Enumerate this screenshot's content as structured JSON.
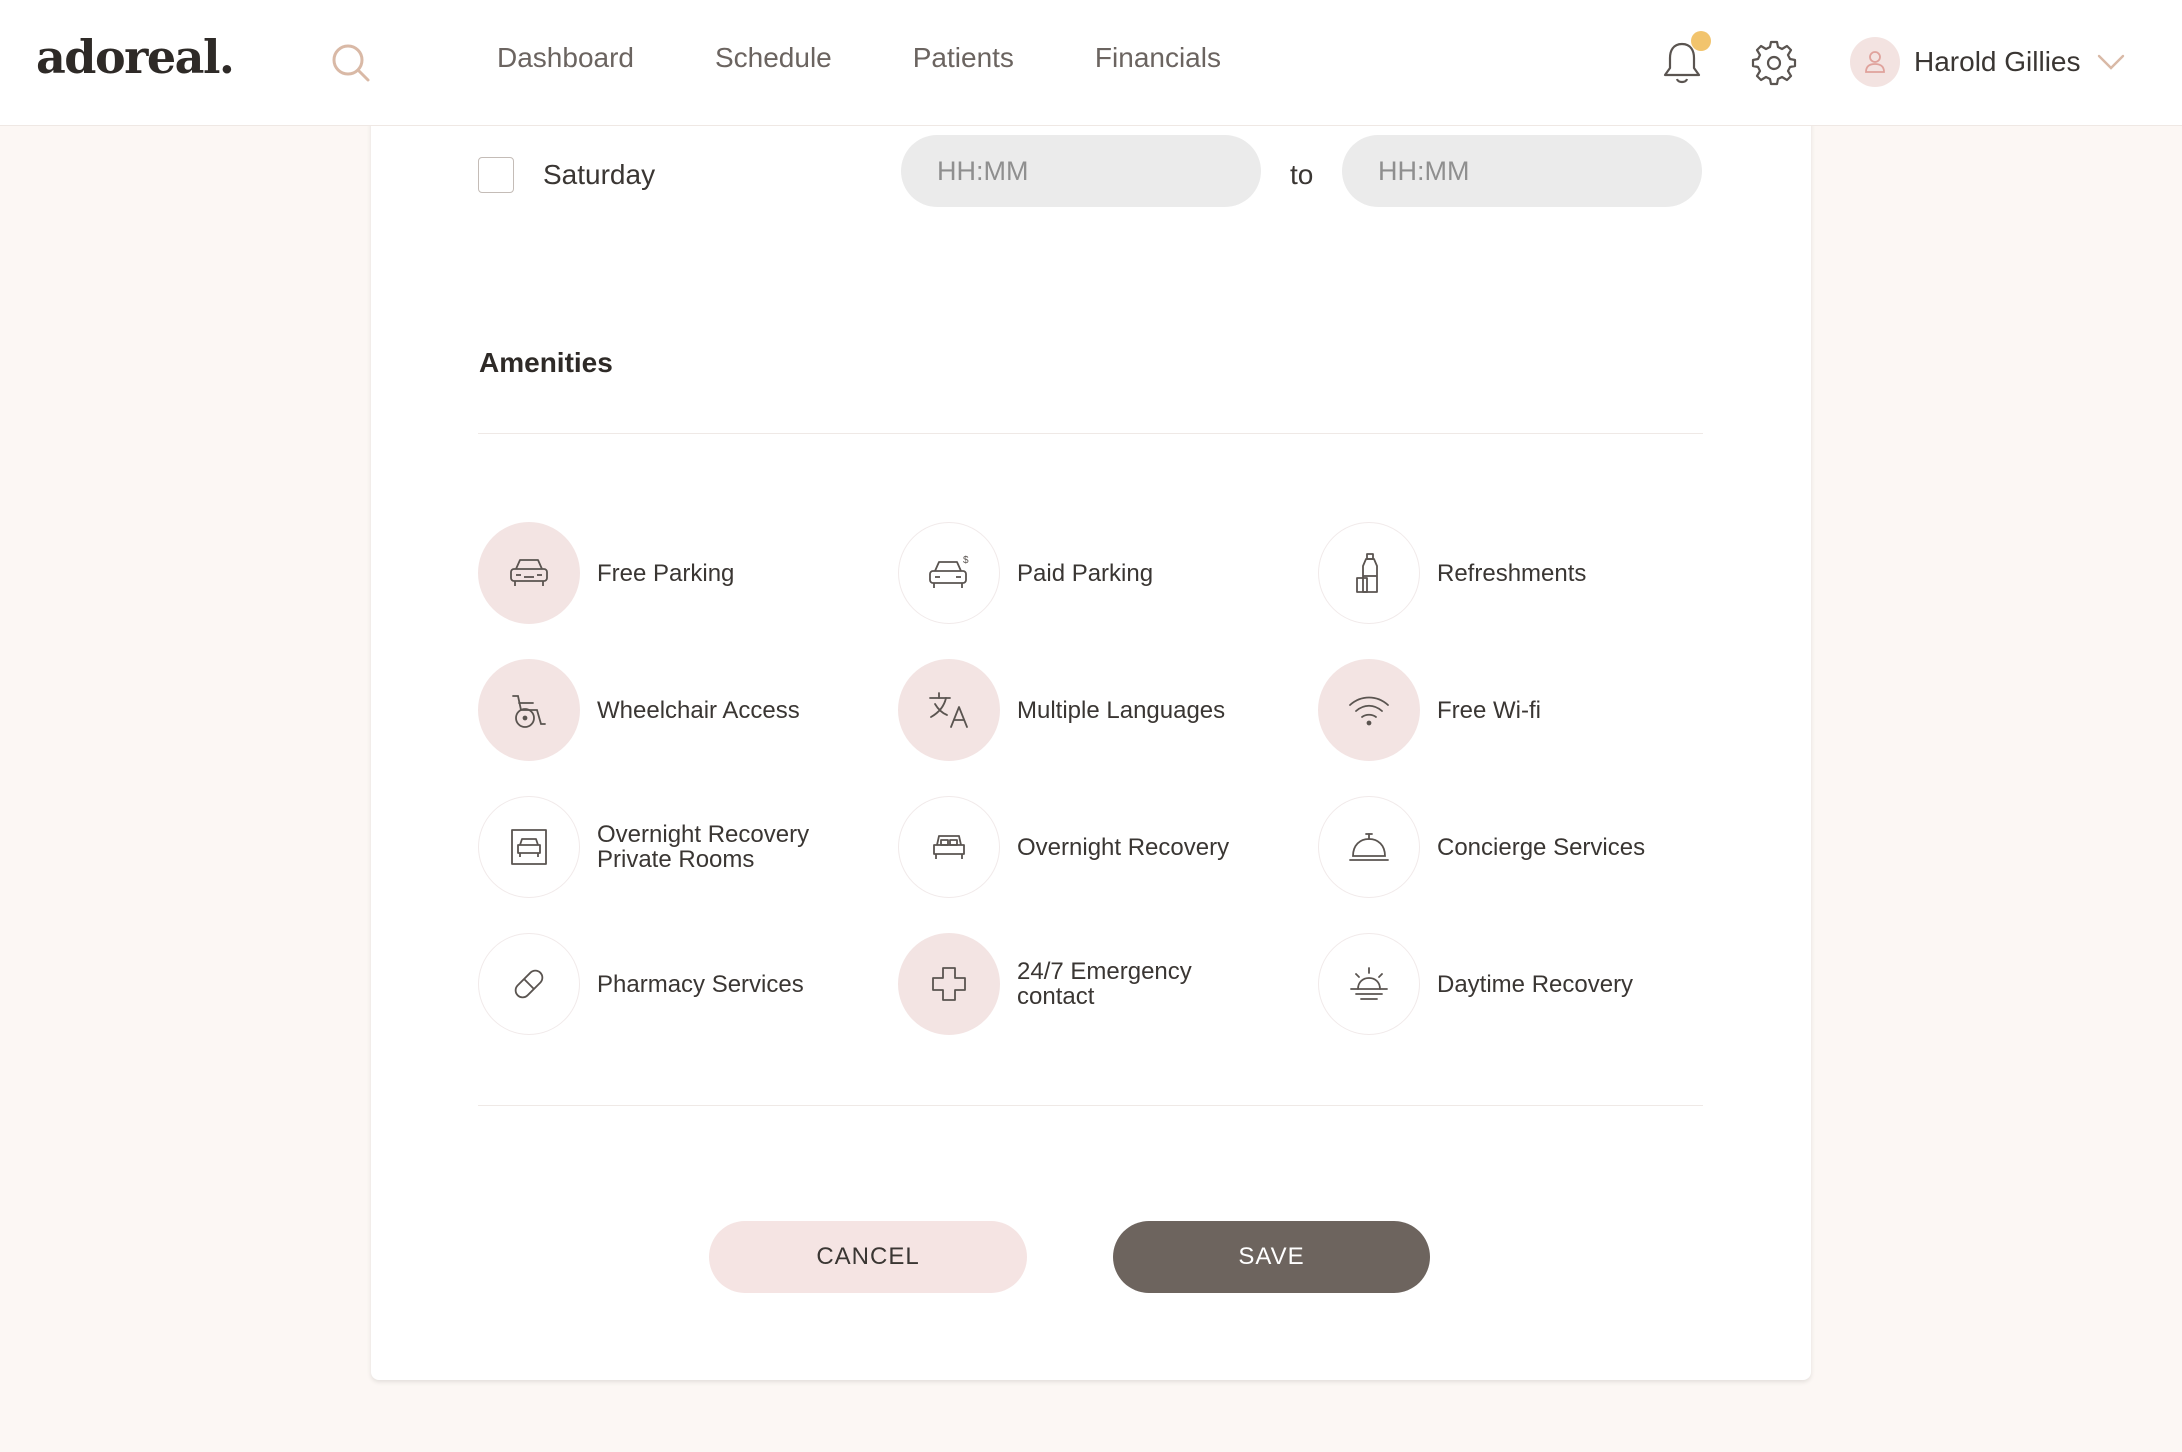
{
  "header": {
    "logo": "adoreal.",
    "nav": [
      "Dashboard",
      "Schedule",
      "Patients",
      "Financials"
    ],
    "user_name": "Harold Gillies",
    "icons": {
      "search": "search-icon",
      "notifications": "bell-icon",
      "settings": "gear-icon",
      "avatar": "user-icon",
      "menu": "chevron-down-icon"
    },
    "notification_dot_color": "#f2c46d"
  },
  "schedule": {
    "day": "Saturday",
    "checked": false,
    "from_placeholder": "HH:MM",
    "to_placeholder": "HH:MM",
    "to_label": "to"
  },
  "amenities": {
    "title": "Amenities",
    "items": [
      {
        "label": "Free Parking",
        "icon": "car-icon",
        "selected": true
      },
      {
        "label": "Paid Parking",
        "icon": "paid-car-icon",
        "selected": false
      },
      {
        "label": "Refreshments",
        "icon": "bottle-icon",
        "selected": false
      },
      {
        "label": "Wheelchair Access",
        "icon": "wheelchair-icon",
        "selected": true
      },
      {
        "label": "Multiple Languages",
        "icon": "translate-icon",
        "selected": true
      },
      {
        "label": "Free Wi-fi",
        "icon": "wifi-icon",
        "selected": true
      },
      {
        "label": "Overnight Recovery Private Rooms",
        "icon": "private-room-icon",
        "selected": false
      },
      {
        "label": "Overnight Recovery",
        "icon": "bed-icon",
        "selected": false
      },
      {
        "label": "Concierge Services",
        "icon": "service-bell-icon",
        "selected": false
      },
      {
        "label": "Pharmacy Services",
        "icon": "pill-icon",
        "selected": false
      },
      {
        "label": "24/7 Emergency contact",
        "icon": "medical-cross-icon",
        "selected": true
      },
      {
        "label": "Daytime Recovery",
        "icon": "sunrise-icon",
        "selected": false
      }
    ]
  },
  "actions": {
    "cancel": "CANCEL",
    "save": "SAVE"
  },
  "colors": {
    "accent_pink": "#f3e4e3",
    "save_button": "#6d645e",
    "page_bg": "#fcf7f4",
    "search_icon": "#d9b9a6"
  }
}
